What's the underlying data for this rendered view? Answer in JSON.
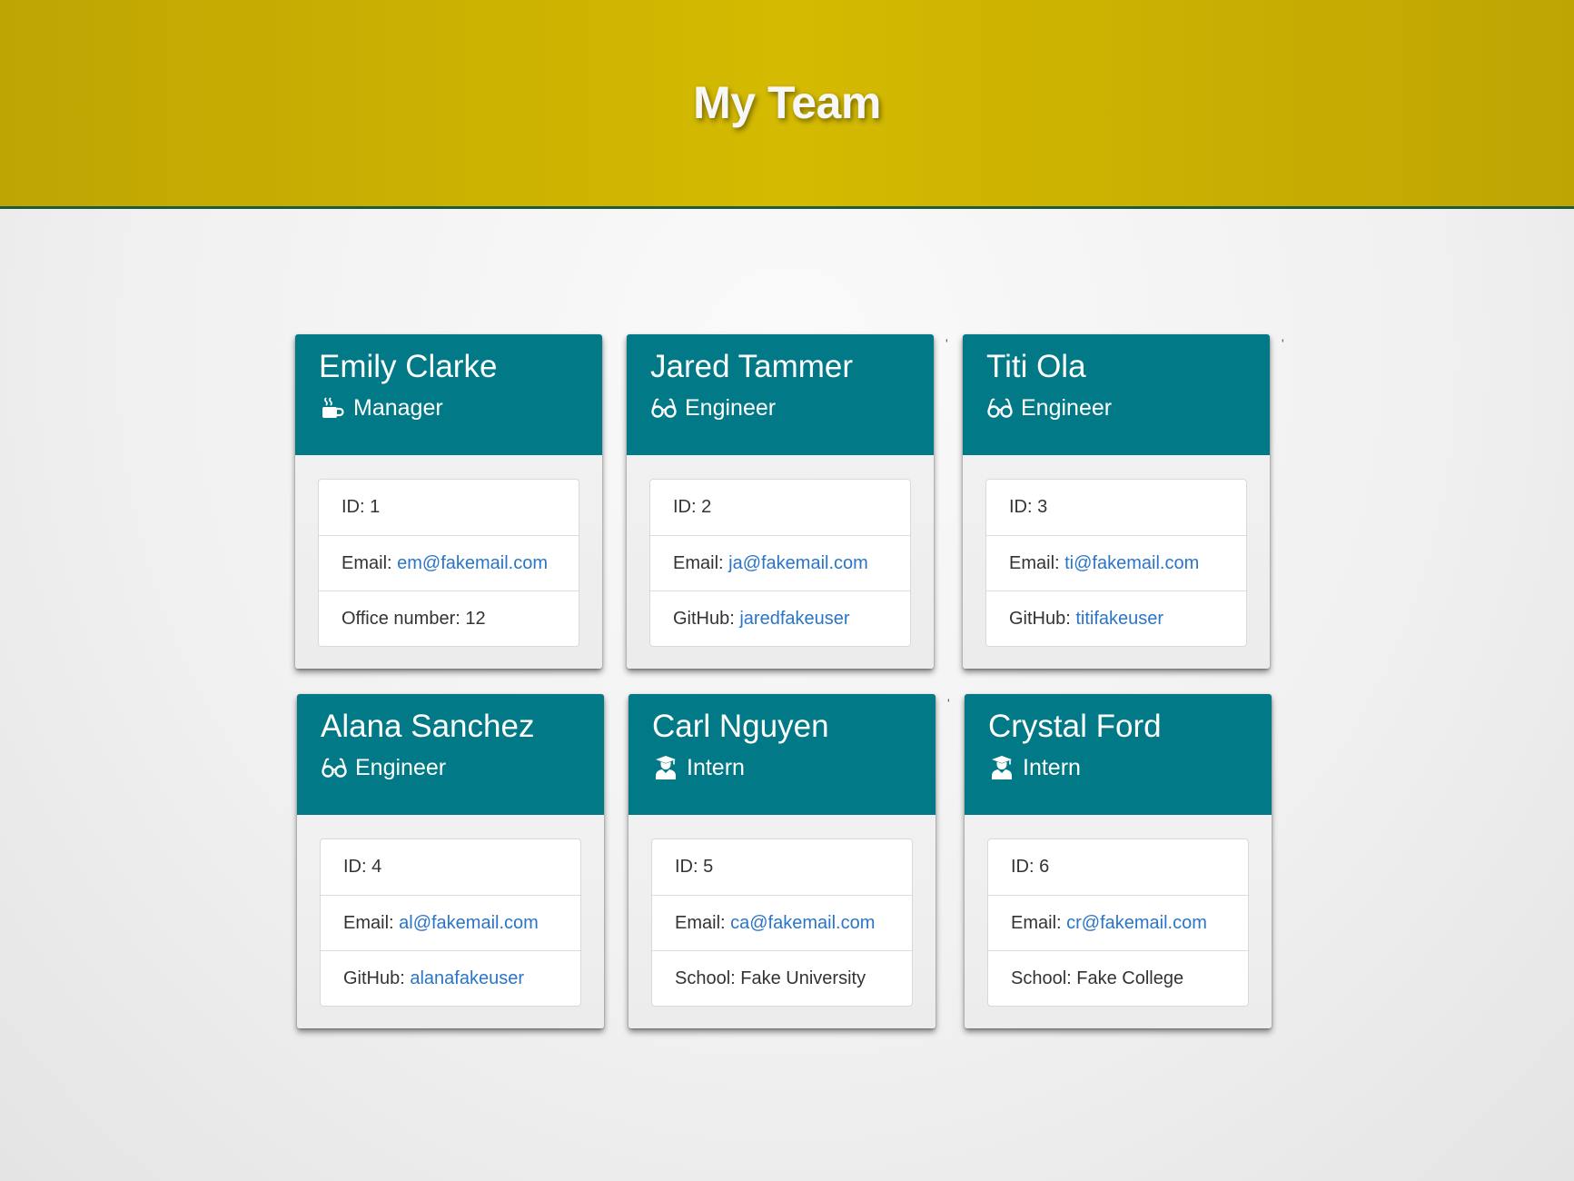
{
  "header": {
    "title": "My Team"
  },
  "colors": {
    "header_bg": "#d4ba00",
    "card_header_bg": "#027986",
    "link": "#2a75c8"
  },
  "stray_marks": [
    "'",
    "'",
    "'"
  ],
  "team": [
    {
      "name": "Emily Clarke",
      "role": "Manager",
      "role_icon": "coffee-mug-icon",
      "id_text": "ID: 1",
      "email_label": "Email: ",
      "email": "em@fakemail.com",
      "extra_label": "Office number: 12",
      "extra_link": ""
    },
    {
      "name": "Jared Tammer",
      "role": "Engineer",
      "role_icon": "glasses-icon",
      "id_text": "ID: 2",
      "email_label": "Email: ",
      "email": "ja@fakemail.com",
      "extra_label": "GitHub: ",
      "extra_link": "jaredfakeuser"
    },
    {
      "name": "Titi Ola",
      "role": "Engineer",
      "role_icon": "glasses-icon",
      "id_text": "ID: 3",
      "email_label": "Email: ",
      "email": "ti@fakemail.com",
      "extra_label": "GitHub: ",
      "extra_link": "titifakeuser"
    },
    {
      "name": "Alana Sanchez",
      "role": "Engineer",
      "role_icon": "glasses-icon",
      "id_text": "ID: 4",
      "email_label": "Email: ",
      "email": "al@fakemail.com",
      "extra_label": "GitHub: ",
      "extra_link": "alanafakeuser"
    },
    {
      "name": "Carl Nguyen",
      "role": "Intern",
      "role_icon": "graduate-icon",
      "id_text": "ID: 5",
      "email_label": "Email: ",
      "email": "ca@fakemail.com",
      "extra_label": "School: Fake University",
      "extra_link": ""
    },
    {
      "name": "Crystal Ford",
      "role": "Intern",
      "role_icon": "graduate-icon",
      "id_text": "ID: 6",
      "email_label": "Email: ",
      "email": "cr@fakemail.com",
      "extra_label": "School: Fake College",
      "extra_link": ""
    }
  ]
}
